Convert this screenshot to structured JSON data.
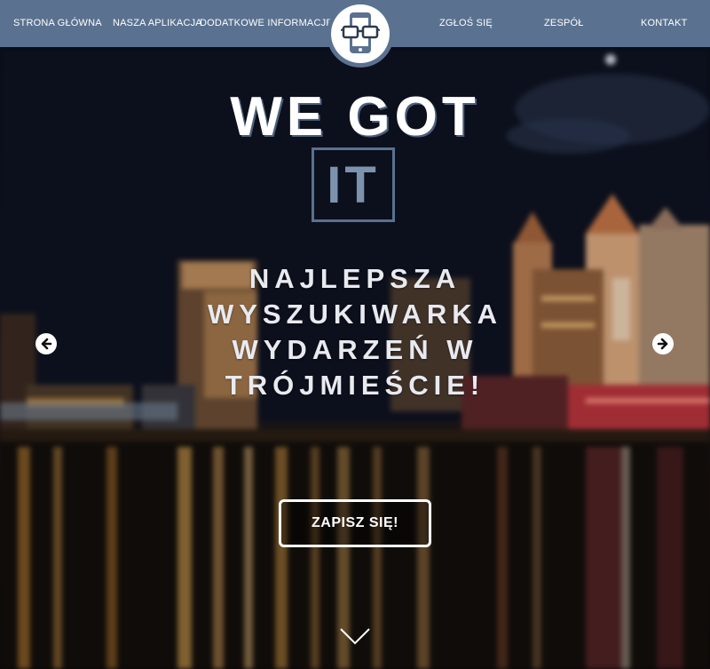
{
  "nav": {
    "items": [
      {
        "label": "STRONA GŁÓWNA"
      },
      {
        "label": "NASZA APLIKACJA"
      },
      {
        "label": "DODATKOWE INFORMACJE"
      },
      {
        "label": "ZGŁOŚ SIĘ"
      },
      {
        "label": "ZESPÓŁ"
      },
      {
        "label": "KONTAKT"
      }
    ],
    "logo_icon": "phone-with-glasses-icon"
  },
  "hero": {
    "headline": "WE GOT",
    "headline_box": "IT",
    "tagline_lines": [
      "NAJLEPSZA",
      "WYSZUKIWARKA",
      "WYDARZEŃ W",
      "TRÓJMIEŚCIE!"
    ],
    "cta_label": "ZAPISZ SIĘ!",
    "prev_icon": "arrow-left-icon",
    "next_icon": "arrow-right-icon",
    "scroll_icon": "chevron-down-icon"
  },
  "colors": {
    "nav_bg": "#5a7190",
    "accent": "#7d92ad",
    "text": "#ffffff"
  }
}
